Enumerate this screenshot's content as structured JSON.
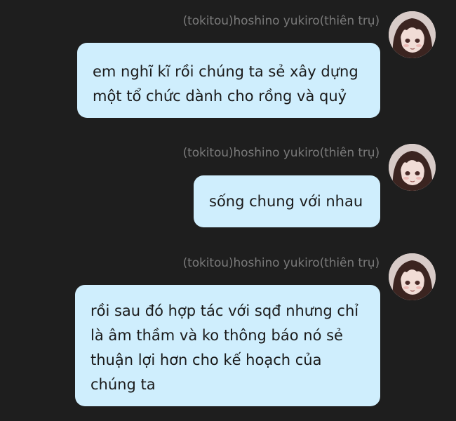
{
  "messages": [
    {
      "sender": "(tokitou)hoshino yukiro(thiên trụ)",
      "avatar_icon": "user-avatar-icon",
      "text": "em nghĩ kĩ rồi chúng ta sẻ xây dựng\nmột tổ chức dành cho rồng và quỷ"
    },
    {
      "sender": "(tokitou)hoshino yukiro(thiên trụ)",
      "avatar_icon": "user-avatar-icon",
      "text": "sống chung với nhau"
    },
    {
      "sender": "(tokitou)hoshino yukiro(thiên trụ)",
      "avatar_icon": "user-avatar-icon",
      "text": "rồi sau đó hợp tác với sqđ nhưng chỉ\nlà âm thầm và ko thông báo nó sẻ\nthuận lợi hơn cho kế hoạch của\nchúng ta"
    }
  ],
  "colors": {
    "background": "#1e1e1e",
    "bubble": "#cfeefd",
    "sender_text": "#7a7a7a",
    "message_text": "#1a1a1a"
  }
}
